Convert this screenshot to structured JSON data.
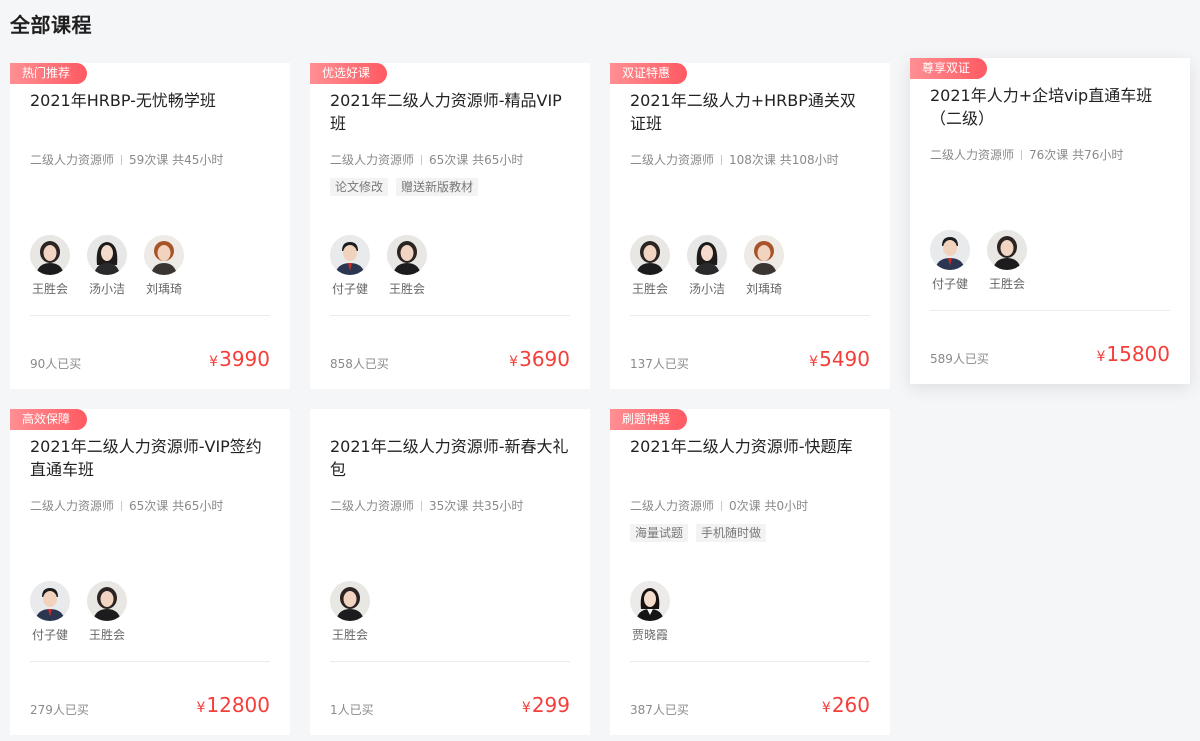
{
  "page_title": "全部课程",
  "courses": [
    {
      "ribbon": "热门推荐",
      "title": "2021年HRBP-无忧畅学班",
      "category": "二级人力资源师",
      "lessons": "59次课 共45小时",
      "features": [],
      "teachers": [
        {
          "name": "王胜会"
        },
        {
          "name": "汤小洁"
        },
        {
          "name": "刘瑀琦"
        }
      ],
      "buyers": "90人已买",
      "currency": "¥",
      "price": "3990"
    },
    {
      "ribbon": "优选好课",
      "title": "2021年二级人力资源师-精品VIP班",
      "category": "二级人力资源师",
      "lessons": "65次课 共65小时",
      "features": [
        "论文修改",
        "赠送新版教材"
      ],
      "teachers": [
        {
          "name": "付子健"
        },
        {
          "name": "王胜会"
        }
      ],
      "buyers": "858人已买",
      "currency": "¥",
      "price": "3690"
    },
    {
      "ribbon": "双证特惠",
      "title": "2021年二级人力+HRBP通关双证班",
      "category": "二级人力资源师",
      "lessons": "108次课 共108小时",
      "features": [],
      "teachers": [
        {
          "name": "王胜会"
        },
        {
          "name": "汤小洁"
        },
        {
          "name": "刘瑀琦"
        }
      ],
      "buyers": "137人已买",
      "currency": "¥",
      "price": "5490"
    },
    {
      "ribbon": "尊享双证",
      "title": "2021年人力+企培vip直通车班（二级）",
      "category": "二级人力资源师",
      "lessons": "76次课 共76小时",
      "features": [],
      "teachers": [
        {
          "name": "付子健"
        },
        {
          "name": "王胜会"
        }
      ],
      "buyers": "589人已买",
      "currency": "¥",
      "price": "15800"
    },
    {
      "ribbon": "高效保障",
      "title": "2021年二级人力资源师-VIP签约直通车班",
      "category": "二级人力资源师",
      "lessons": "65次课 共65小时",
      "features": [],
      "teachers": [
        {
          "name": "付子健"
        },
        {
          "name": "王胜会"
        }
      ],
      "buyers": "279人已买",
      "currency": "¥",
      "price": "12800"
    },
    {
      "ribbon": "",
      "title": "2021年二级人力资源师-新春大礼包",
      "category": "二级人力资源师",
      "lessons": "35次课 共35小时",
      "features": [],
      "teachers": [
        {
          "name": "王胜会"
        }
      ],
      "buyers": "1人已买",
      "currency": "¥",
      "price": "299"
    },
    {
      "ribbon": "刷题神器",
      "title": "2021年二级人力资源师-快题库",
      "category": "二级人力资源师",
      "lessons": "0次课 共0小时",
      "features": [
        "海量试题",
        "手机随时做"
      ],
      "teachers": [
        {
          "name": "贾晓霞"
        }
      ],
      "buyers": "387人已买",
      "currency": "¥",
      "price": "260"
    }
  ]
}
